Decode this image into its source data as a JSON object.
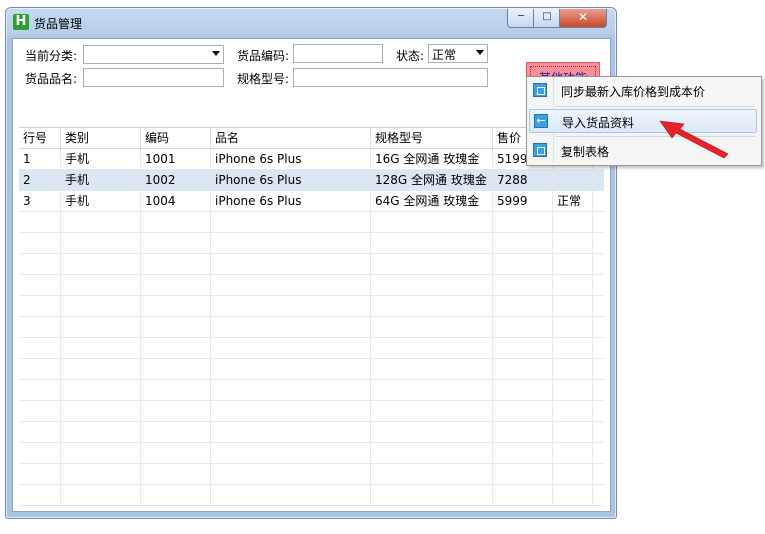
{
  "window": {
    "title": "货品管理",
    "app_icon_letter": "H",
    "min_label": "─",
    "max_label": "□",
    "close_label": "✕"
  },
  "filters": {
    "category_label": "当前分类:",
    "category_value": "",
    "code_label": "货品编码:",
    "code_value": "",
    "status_label": "状态:",
    "status_value": "正常",
    "name_label": "货品品名:",
    "name_value": "",
    "spec_label": "规格型号:",
    "spec_value": ""
  },
  "other_button_label": "其他功能",
  "grid": {
    "columns": [
      "行号",
      "类别",
      "编码",
      "品名",
      "规格型号",
      "售价",
      ""
    ],
    "rows": [
      [
        "1",
        "手机",
        "1001",
        "iPhone 6s Plus",
        "16G 全网通 玫瑰金",
        "5199",
        ""
      ],
      [
        "2",
        "手机",
        "1002",
        "iPhone 6s Plus",
        "128G 全网通 玫瑰金",
        "7288",
        ""
      ],
      [
        "3",
        "手机",
        "1004",
        "iPhone 6s Plus",
        "64G 全网通 玫瑰金",
        "5999",
        "正常"
      ]
    ],
    "selected_row": 1
  },
  "menu": {
    "items": [
      {
        "label": "同步最新入库价格到成本价",
        "icon": "sync-icon"
      },
      {
        "label": "导入货品资料",
        "icon": "import-arrow-icon"
      },
      {
        "label": "复制表格",
        "icon": "copy-table-icon"
      }
    ],
    "hovered_index": 1
  },
  "colors": {
    "other_button_bg": "#ff8f96",
    "pointer_arrow": "#e8202a",
    "selection": "#dbe6f4"
  }
}
